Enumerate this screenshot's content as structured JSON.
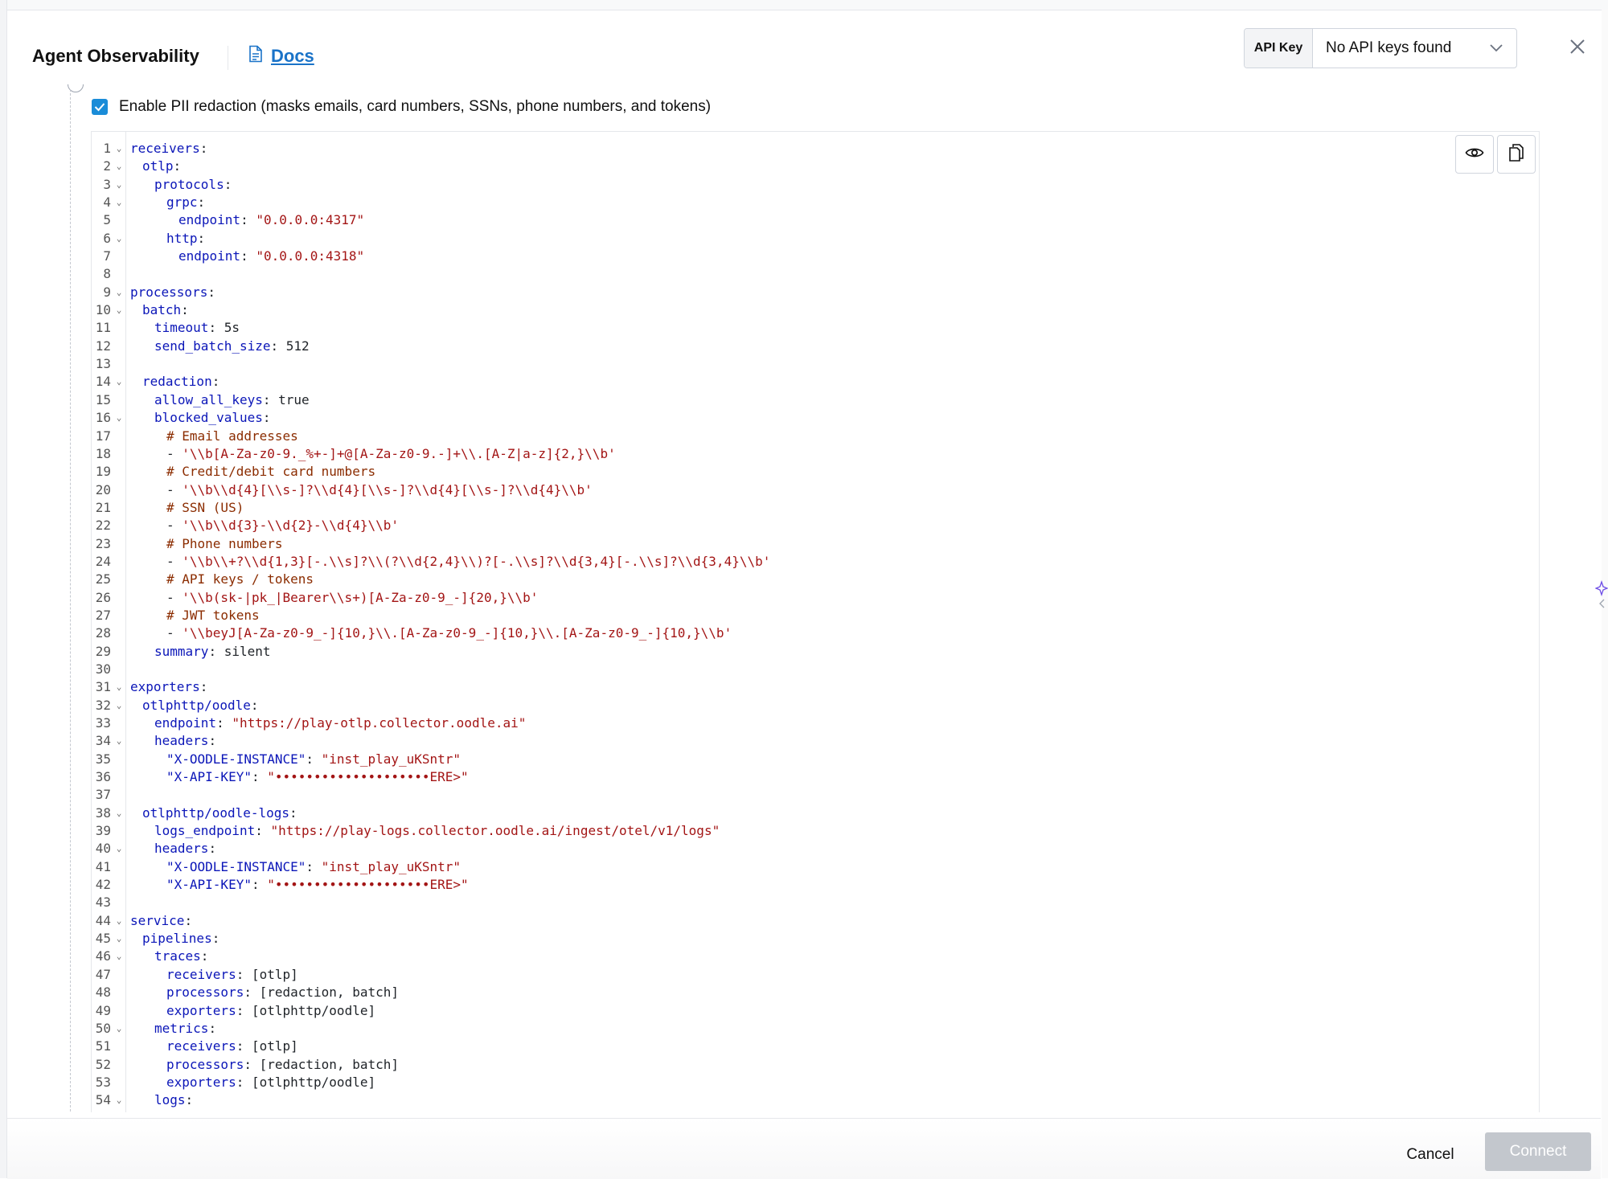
{
  "header": {
    "title": "Agent Observability",
    "docs_label": "Docs",
    "api_key_label": "API Key",
    "api_key_value": "No API keys found"
  },
  "pii": {
    "checked": true,
    "label": "Enable PII redaction (masks emails, card numbers, SSNs, phone numbers, and tokens)"
  },
  "editor": {
    "lines": [
      {
        "n": "1",
        "fold": true,
        "indent": 0,
        "segs": [
          [
            "k",
            "receivers"
          ],
          [
            "p",
            ":"
          ]
        ]
      },
      {
        "n": "2",
        "fold": true,
        "indent": 2,
        "segs": [
          [
            "k",
            "otlp"
          ],
          [
            "p",
            ":"
          ]
        ]
      },
      {
        "n": "3",
        "fold": true,
        "indent": 4,
        "segs": [
          [
            "k",
            "protocols"
          ],
          [
            "p",
            ":"
          ]
        ]
      },
      {
        "n": "4",
        "fold": true,
        "indent": 6,
        "segs": [
          [
            "k",
            "grpc"
          ],
          [
            "p",
            ":"
          ]
        ]
      },
      {
        "n": "5",
        "fold": false,
        "indent": 8,
        "segs": [
          [
            "k",
            "endpoint"
          ],
          [
            "p",
            ": "
          ],
          [
            "s",
            "\"0.0.0.0:4317\""
          ]
        ]
      },
      {
        "n": "6",
        "fold": true,
        "indent": 6,
        "segs": [
          [
            "k",
            "http"
          ],
          [
            "p",
            ":"
          ]
        ]
      },
      {
        "n": "7",
        "fold": false,
        "indent": 8,
        "segs": [
          [
            "k",
            "endpoint"
          ],
          [
            "p",
            ": "
          ],
          [
            "s",
            "\"0.0.0.0:4318\""
          ]
        ]
      },
      {
        "n": "8",
        "fold": false,
        "indent": 0,
        "segs": []
      },
      {
        "n": "9",
        "fold": true,
        "indent": 0,
        "segs": [
          [
            "k",
            "processors"
          ],
          [
            "p",
            ":"
          ]
        ]
      },
      {
        "n": "10",
        "fold": true,
        "indent": 2,
        "segs": [
          [
            "k",
            "batch"
          ],
          [
            "p",
            ":"
          ]
        ]
      },
      {
        "n": "11",
        "fold": false,
        "indent": 4,
        "segs": [
          [
            "k",
            "timeout"
          ],
          [
            "p",
            ": "
          ],
          [
            "v",
            "5s"
          ]
        ]
      },
      {
        "n": "12",
        "fold": false,
        "indent": 4,
        "segs": [
          [
            "k",
            "send_batch_size"
          ],
          [
            "p",
            ": "
          ],
          [
            "v",
            "512"
          ]
        ]
      },
      {
        "n": "13",
        "fold": false,
        "indent": 0,
        "segs": []
      },
      {
        "n": "14",
        "fold": true,
        "indent": 2,
        "segs": [
          [
            "k",
            "redaction"
          ],
          [
            "p",
            ":"
          ]
        ]
      },
      {
        "n": "15",
        "fold": false,
        "indent": 4,
        "segs": [
          [
            "k",
            "allow_all_keys"
          ],
          [
            "p",
            ": "
          ],
          [
            "v",
            "true"
          ]
        ]
      },
      {
        "n": "16",
        "fold": true,
        "indent": 4,
        "segs": [
          [
            "k",
            "blocked_values"
          ],
          [
            "p",
            ":"
          ]
        ]
      },
      {
        "n": "17",
        "fold": false,
        "indent": 6,
        "segs": [
          [
            "c",
            "# Email addresses"
          ]
        ]
      },
      {
        "n": "18",
        "fold": false,
        "indent": 6,
        "segs": [
          [
            "p",
            "- "
          ],
          [
            "s",
            "'\\\\b[A-Za-z0-9._%+-]+@[A-Za-z0-9.-]+\\\\.[A-Z|a-z]{2,}\\\\b'"
          ]
        ]
      },
      {
        "n": "19",
        "fold": false,
        "indent": 6,
        "segs": [
          [
            "c",
            "# Credit/debit card numbers"
          ]
        ]
      },
      {
        "n": "20",
        "fold": false,
        "indent": 6,
        "segs": [
          [
            "p",
            "- "
          ],
          [
            "s",
            "'\\\\b\\\\d{4}[\\\\s-]?\\\\d{4}[\\\\s-]?\\\\d{4}[\\\\s-]?\\\\d{4}\\\\b'"
          ]
        ]
      },
      {
        "n": "21",
        "fold": false,
        "indent": 6,
        "segs": [
          [
            "c",
            "# SSN (US)"
          ]
        ]
      },
      {
        "n": "22",
        "fold": false,
        "indent": 6,
        "segs": [
          [
            "p",
            "- "
          ],
          [
            "s",
            "'\\\\b\\\\d{3}-\\\\d{2}-\\\\d{4}\\\\b'"
          ]
        ]
      },
      {
        "n": "23",
        "fold": false,
        "indent": 6,
        "segs": [
          [
            "c",
            "# Phone numbers"
          ]
        ]
      },
      {
        "n": "24",
        "fold": false,
        "indent": 6,
        "segs": [
          [
            "p",
            "- "
          ],
          [
            "s",
            "'\\\\b\\\\+?\\\\d{1,3}[-.\\\\s]?\\\\(?\\\\d{2,4}\\\\)?[-.\\\\s]?\\\\d{3,4}[-.\\\\s]?\\\\d{3,4}\\\\b'"
          ]
        ]
      },
      {
        "n": "25",
        "fold": false,
        "indent": 6,
        "segs": [
          [
            "c",
            "# API keys / tokens"
          ]
        ]
      },
      {
        "n": "26",
        "fold": false,
        "indent": 6,
        "segs": [
          [
            "p",
            "- "
          ],
          [
            "s",
            "'\\\\b(sk-|pk_|Bearer\\\\s+)[A-Za-z0-9_-]{20,}\\\\b'"
          ]
        ]
      },
      {
        "n": "27",
        "fold": false,
        "indent": 6,
        "segs": [
          [
            "c",
            "# JWT tokens"
          ]
        ]
      },
      {
        "n": "28",
        "fold": false,
        "indent": 6,
        "segs": [
          [
            "p",
            "- "
          ],
          [
            "s",
            "'\\\\beyJ[A-Za-z0-9_-]{10,}\\\\.[A-Za-z0-9_-]{10,}\\\\.[A-Za-z0-9_-]{10,}\\\\b'"
          ]
        ]
      },
      {
        "n": "29",
        "fold": false,
        "indent": 4,
        "segs": [
          [
            "k",
            "summary"
          ],
          [
            "p",
            ": "
          ],
          [
            "v",
            "silent"
          ]
        ]
      },
      {
        "n": "30",
        "fold": false,
        "indent": 0,
        "segs": []
      },
      {
        "n": "31",
        "fold": true,
        "indent": 0,
        "segs": [
          [
            "k",
            "exporters"
          ],
          [
            "p",
            ":"
          ]
        ]
      },
      {
        "n": "32",
        "fold": true,
        "indent": 2,
        "segs": [
          [
            "k",
            "otlphttp/oodle"
          ],
          [
            "p",
            ":"
          ]
        ]
      },
      {
        "n": "33",
        "fold": false,
        "indent": 4,
        "segs": [
          [
            "k",
            "endpoint"
          ],
          [
            "p",
            ": "
          ],
          [
            "s",
            "\"https://play-otlp.collector.oodle.ai\""
          ]
        ]
      },
      {
        "n": "34",
        "fold": true,
        "indent": 4,
        "segs": [
          [
            "k",
            "headers"
          ],
          [
            "p",
            ":"
          ]
        ]
      },
      {
        "n": "35",
        "fold": false,
        "indent": 6,
        "segs": [
          [
            "k",
            "\"X-OODLE-INSTANCE\""
          ],
          [
            "p",
            ": "
          ],
          [
            "s",
            "\"inst_play_uKSntr\""
          ]
        ]
      },
      {
        "n": "36",
        "fold": false,
        "indent": 6,
        "segs": [
          [
            "k",
            "\"X-API-KEY\""
          ],
          [
            "p",
            ": "
          ],
          [
            "s",
            "\"••••••••••••••••••••ERE>\""
          ]
        ]
      },
      {
        "n": "37",
        "fold": false,
        "indent": 0,
        "segs": []
      },
      {
        "n": "38",
        "fold": true,
        "indent": 2,
        "segs": [
          [
            "k",
            "otlphttp/oodle-logs"
          ],
          [
            "p",
            ":"
          ]
        ]
      },
      {
        "n": "39",
        "fold": false,
        "indent": 4,
        "segs": [
          [
            "k",
            "logs_endpoint"
          ],
          [
            "p",
            ": "
          ],
          [
            "s",
            "\"https://play-logs.collector.oodle.ai/ingest/otel/v1/logs\""
          ]
        ]
      },
      {
        "n": "40",
        "fold": true,
        "indent": 4,
        "segs": [
          [
            "k",
            "headers"
          ],
          [
            "p",
            ":"
          ]
        ]
      },
      {
        "n": "41",
        "fold": false,
        "indent": 6,
        "segs": [
          [
            "k",
            "\"X-OODLE-INSTANCE\""
          ],
          [
            "p",
            ": "
          ],
          [
            "s",
            "\"inst_play_uKSntr\""
          ]
        ]
      },
      {
        "n": "42",
        "fold": false,
        "indent": 6,
        "segs": [
          [
            "k",
            "\"X-API-KEY\""
          ],
          [
            "p",
            ": "
          ],
          [
            "s",
            "\"••••••••••••••••••••ERE>\""
          ]
        ]
      },
      {
        "n": "43",
        "fold": false,
        "indent": 0,
        "segs": []
      },
      {
        "n": "44",
        "fold": true,
        "indent": 0,
        "segs": [
          [
            "k",
            "service"
          ],
          [
            "p",
            ":"
          ]
        ]
      },
      {
        "n": "45",
        "fold": true,
        "indent": 2,
        "segs": [
          [
            "k",
            "pipelines"
          ],
          [
            "p",
            ":"
          ]
        ]
      },
      {
        "n": "46",
        "fold": true,
        "indent": 4,
        "segs": [
          [
            "k",
            "traces"
          ],
          [
            "p",
            ":"
          ]
        ]
      },
      {
        "n": "47",
        "fold": false,
        "indent": 6,
        "segs": [
          [
            "k",
            "receivers"
          ],
          [
            "p",
            ": "
          ],
          [
            "v",
            "[otlp]"
          ]
        ]
      },
      {
        "n": "48",
        "fold": false,
        "indent": 6,
        "segs": [
          [
            "k",
            "processors"
          ],
          [
            "p",
            ": "
          ],
          [
            "v",
            "[redaction, batch]"
          ]
        ]
      },
      {
        "n": "49",
        "fold": false,
        "indent": 6,
        "segs": [
          [
            "k",
            "exporters"
          ],
          [
            "p",
            ": "
          ],
          [
            "v",
            "[otlphttp/oodle]"
          ]
        ]
      },
      {
        "n": "50",
        "fold": true,
        "indent": 4,
        "segs": [
          [
            "k",
            "metrics"
          ],
          [
            "p",
            ":"
          ]
        ]
      },
      {
        "n": "51",
        "fold": false,
        "indent": 6,
        "segs": [
          [
            "k",
            "receivers"
          ],
          [
            "p",
            ": "
          ],
          [
            "v",
            "[otlp]"
          ]
        ]
      },
      {
        "n": "52",
        "fold": false,
        "indent": 6,
        "segs": [
          [
            "k",
            "processors"
          ],
          [
            "p",
            ": "
          ],
          [
            "v",
            "[redaction, batch]"
          ]
        ]
      },
      {
        "n": "53",
        "fold": false,
        "indent": 6,
        "segs": [
          [
            "k",
            "exporters"
          ],
          [
            "p",
            ": "
          ],
          [
            "v",
            "[otlphttp/oodle]"
          ]
        ]
      },
      {
        "n": "54",
        "fold": true,
        "indent": 4,
        "segs": [
          [
            "k",
            "logs"
          ],
          [
            "p",
            ":"
          ]
        ]
      }
    ],
    "tools": [
      {
        "name": "toggle-visibility-button",
        "icon": "eye-icon"
      },
      {
        "name": "copy-button",
        "icon": "copy-icon"
      }
    ]
  },
  "footer": {
    "cancel_label": "Cancel",
    "connect_label": "Connect"
  },
  "colors": {
    "key": "#0b16b8",
    "string": "#a31515",
    "comment": "#8b2c00",
    "link": "#1a73c8",
    "checkbox": "#1a8cd8",
    "connect_disabled": "#c3c7cd"
  }
}
